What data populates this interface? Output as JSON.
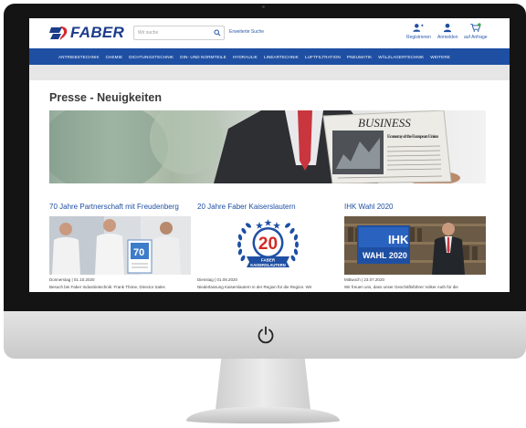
{
  "header": {
    "logo_text": "FABER",
    "search_placeholder": "Wir suche",
    "advanced_search": "Erweiterte Suche",
    "actions": [
      {
        "label": "Registrieren",
        "icon": "register-icon"
      },
      {
        "label": "Anmelden",
        "icon": "user-icon"
      },
      {
        "label": "auf Anfrage",
        "icon": "cart-icon"
      }
    ],
    "cart_count": "0"
  },
  "nav": {
    "items": [
      "ANTRIEBSTECHNIK",
      "CHEMIE",
      "DICHTUNGSTECHNIK",
      "DIN- UND NORMTEILE",
      "HYDRAULIK",
      "LINEARTECHNIK",
      "LUFTFILTRATION",
      "PNEUMATIK",
      "WÄLZLAGERTECHNIK",
      "WEITERE"
    ]
  },
  "page": {
    "title": "Presse - Neuigkeiten",
    "hero": {
      "newspaper_title": "BUSINESS",
      "newspaper_subtitle": "Economy of the European Union"
    }
  },
  "news": [
    {
      "title": "70 Jahre Partnerschaft mit Freudenberg",
      "badge": "70",
      "date": "Donnerstag | 01.10.2020",
      "text": "Besuch bei Faber Industrietechnik: Frank Thöne, Director Sales"
    },
    {
      "title": "20 Jahre Faber Kaiserslautern",
      "badge_number": "20",
      "badge_ribbon_1": "FABER",
      "badge_ribbon_2": "KAISERSLAUTERN",
      "date": "Dienstag | 01.09.2020",
      "text": "Niederlassung Kaiserslautern in der Region für die Region. Wir"
    },
    {
      "title": "IHK Wahl 2020",
      "sign_1": "IHK",
      "sign_2": "WAHL 2020",
      "date": "Mittwoch | 23.07.2020",
      "text": "Wir freuen uns, dass unser Geschäftsführer Volker Auth für die"
    }
  ],
  "colors": {
    "brand_blue": "#1e4fa3",
    "logo_red": "#d6282b",
    "badge_red": "#d32a25"
  },
  "device": {
    "power_icon": "power-icon"
  }
}
